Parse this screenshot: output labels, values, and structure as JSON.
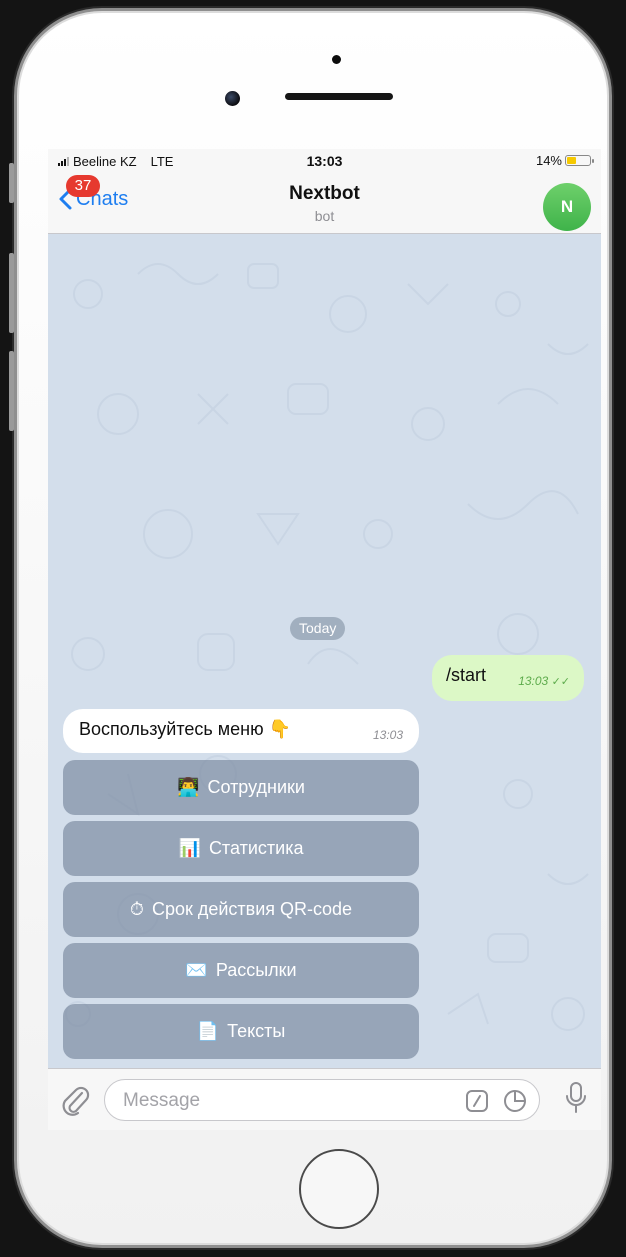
{
  "status": {
    "carrier": "Beeline KZ",
    "network": "LTE",
    "time": "13:03",
    "battery_text": "14%",
    "battery_level": 0.14
  },
  "nav": {
    "back_label": "Chats",
    "unread_badge": "37",
    "title": "Nextbot",
    "subtitle": "bot",
    "avatar_letter": "N",
    "avatar_color": "#4cbb4f"
  },
  "chat": {
    "date_label": "Today",
    "outgoing": {
      "text": "/start",
      "time": "13:03",
      "ticks": "✓✓"
    },
    "incoming": {
      "text": "Воспользуйтесь меню 👇",
      "time": "13:03"
    }
  },
  "keyboard": {
    "buttons": [
      {
        "icon": "👨‍💻",
        "icon_name": "technologist-emoji-icon",
        "label": "Сотрудники"
      },
      {
        "icon": "📊",
        "icon_name": "bar-chart-emoji-icon",
        "label": "Статистика"
      },
      {
        "icon": "⏱",
        "icon_name": "stopwatch-emoji-icon",
        "label": "Срок действия QR-code"
      },
      {
        "icon": "✉️",
        "icon_name": "envelope-emoji-icon",
        "label": "Рассылки"
      },
      {
        "icon": "📄",
        "icon_name": "document-emoji-icon",
        "label": "Тексты"
      }
    ]
  },
  "input": {
    "placeholder": "Message"
  },
  "colors": {
    "accent": "#1e7ef0",
    "badge": "#e6392f",
    "outgoing_bubble": "#dcf8c6",
    "chat_background": "#d3deeb"
  }
}
